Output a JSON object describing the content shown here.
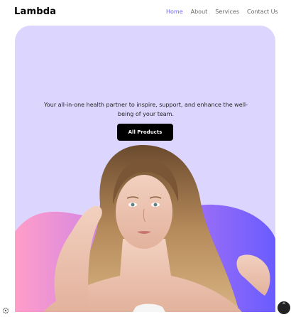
{
  "brand": {
    "name": "Lambda"
  },
  "nav": {
    "items": [
      {
        "label": "Home",
        "active": true
      },
      {
        "label": "About",
        "active": false
      },
      {
        "label": "Services",
        "active": false
      },
      {
        "label": "Contact Us",
        "active": false
      }
    ]
  },
  "hero": {
    "tagline": "Your all-in-one health partner to inspire, support, and enhance the well-being of your team.",
    "cta_label": "All Products",
    "image_subject": "woman-portrait"
  },
  "colors": {
    "accent": "#6b63ff",
    "hero_background": "#dcd6ff",
    "cta_background": "#000000",
    "blob_gradient_start": "#ff9ec8",
    "blob_gradient_end": "#6a5cff"
  },
  "icons": {
    "scroll_top": "chevron-up-icon",
    "corner": "gear-icon"
  }
}
